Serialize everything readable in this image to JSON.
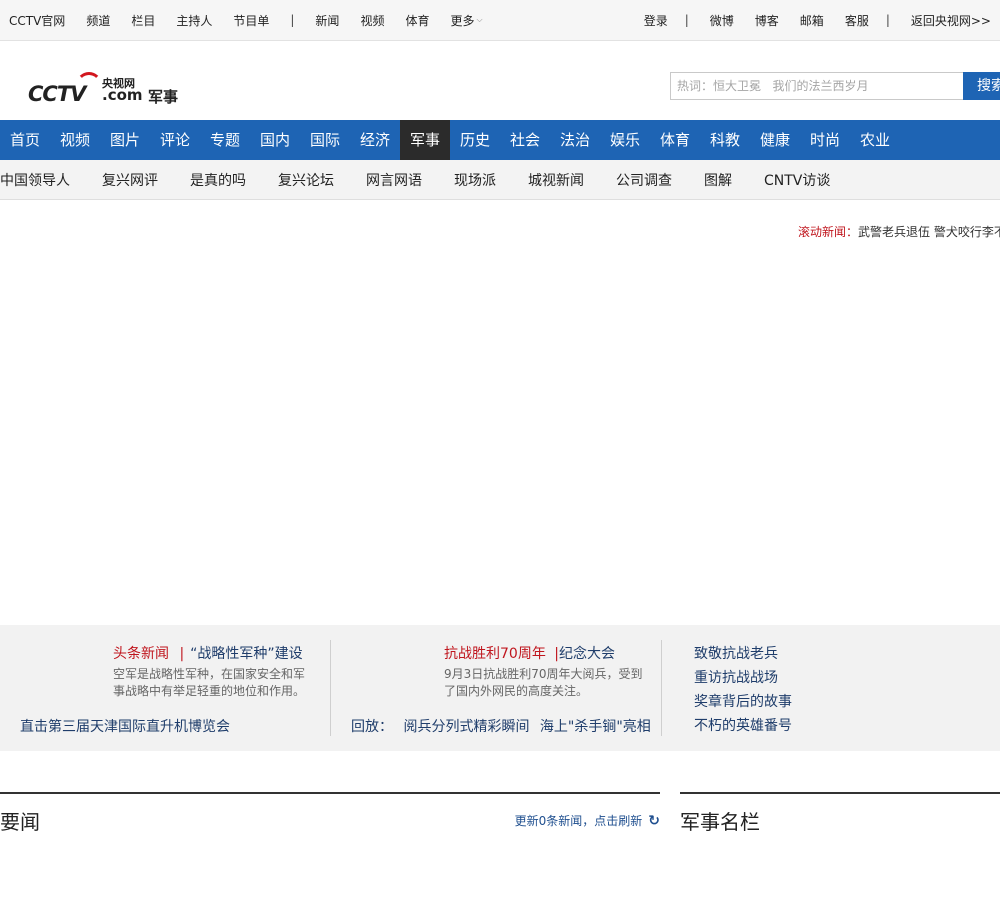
{
  "topbar": {
    "left": [
      "CCTV官网",
      "频道",
      "栏目",
      "主持人",
      "节目单",
      "|",
      "新闻",
      "视频",
      "体育",
      "更多"
    ],
    "right": [
      "登录",
      "|",
      "微博",
      "博客",
      "邮箱",
      "客服",
      "|",
      "返回央视网>>"
    ]
  },
  "logo": {
    "cctv": "CCTV",
    "yang": "央视网",
    "com": ".com",
    "section": "军事"
  },
  "search": {
    "placeholder": "热词：恒大卫冕   我们的法兰西岁月",
    "button": "搜索"
  },
  "mainnav": [
    "首页",
    "视频",
    "图片",
    "评论",
    "专题",
    "国内",
    "国际",
    "经济",
    "军事",
    "历史",
    "社会",
    "法治",
    "娱乐",
    "体育",
    "科教",
    "健康",
    "时尚",
    "农业"
  ],
  "mainnav_active": "军事",
  "subnav": [
    "中国领导人",
    "复兴网评",
    "是真的吗",
    "复兴论坛",
    "网言网语",
    "现场派",
    "城视新闻",
    "公司调查",
    "图解",
    "CNTV访谈"
  ],
  "ticker": {
    "label": "滚动新闻：",
    "text": "武警老兵退伍  警犬咬行李不放"
  },
  "promo": {
    "col1": {
      "label": "头条新闻",
      "sep": "|",
      "title": "“战略性军种”建设",
      "desc": "空军是战略性军种，在国家安全和军事战略中有举足轻重的地位和作用。",
      "link": "直击第三届天津国际直升机博览会"
    },
    "col2": {
      "label": "抗战胜利70周年",
      "sep": "|",
      "title": "纪念大会",
      "desc": "9月3日抗战胜利70周年大阅兵，受到了国内外网民的高度关注。",
      "replay_label": "回放：",
      "links": [
        "阅兵分列式精彩瞬间",
        "海上\"杀手锏\"亮相"
      ]
    },
    "col3": [
      "致敬抗战老兵",
      "重访抗战战场",
      "奖章背后的故事",
      "不朽的英雄番号"
    ]
  },
  "sections": {
    "news": {
      "title": "要闻",
      "refresh": "更新0条新闻，点击刷新"
    },
    "columns": {
      "title": "军事名栏"
    }
  },
  "colors": {
    "brand_blue": "#1e64b4",
    "active_nav": "#2b2b2b",
    "accent_red": "#c0161e",
    "link_dark": "#1f3d6b"
  }
}
